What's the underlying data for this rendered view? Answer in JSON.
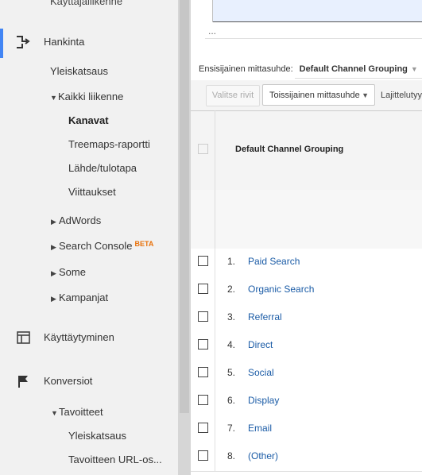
{
  "sidebar": {
    "top_cut_label": "Käyttäjäliikenne",
    "sections": {
      "acquisition": "Hankinta",
      "behavior": "Käyttäytyminen",
      "conversions": "Konversiot"
    },
    "acquisition_items": {
      "overview": "Yleiskatsaus",
      "all_traffic": "Kaikki liikenne",
      "channels": "Kanavat",
      "treemaps": "Treemaps-raportti",
      "source_medium": "Lähde/tulotapa",
      "referrals": "Viittaukset",
      "adwords": "AdWords",
      "search_console": "Search Console",
      "search_console_badge": "BETA",
      "social": "Some",
      "campaigns": "Kampanjat"
    },
    "conversion_items": {
      "goals": "Tavoitteet",
      "overview": "Yleiskatsaus",
      "goal_urls": "Tavoitteen URL-os..."
    }
  },
  "chart": {
    "ellipsis": "..."
  },
  "primary_dimension": {
    "label": "Ensisijainen mittasuhde:",
    "value": "Default Channel Grouping"
  },
  "toolbar": {
    "select_rows": "Valitse rivit",
    "secondary_dimension": "Toissijainen mittasuhde",
    "sort_type": "Lajittelutyyppi"
  },
  "table": {
    "header": "Default Channel Grouping",
    "rows": [
      {
        "n": "1.",
        "label": "Paid Search"
      },
      {
        "n": "2.",
        "label": "Organic Search"
      },
      {
        "n": "3.",
        "label": "Referral"
      },
      {
        "n": "4.",
        "label": "Direct"
      },
      {
        "n": "5.",
        "label": "Social"
      },
      {
        "n": "6.",
        "label": "Display"
      },
      {
        "n": "7.",
        "label": "Email"
      },
      {
        "n": "8.",
        "label": "(Other)"
      }
    ]
  },
  "colors": {
    "accent": "#4285f4",
    "link": "#1a5ba6",
    "beta": "#e8710a"
  },
  "icons": {
    "acquisition": "acquisition-arrows-icon",
    "behavior": "behavior-layout-icon",
    "conversions": "flag-icon"
  }
}
